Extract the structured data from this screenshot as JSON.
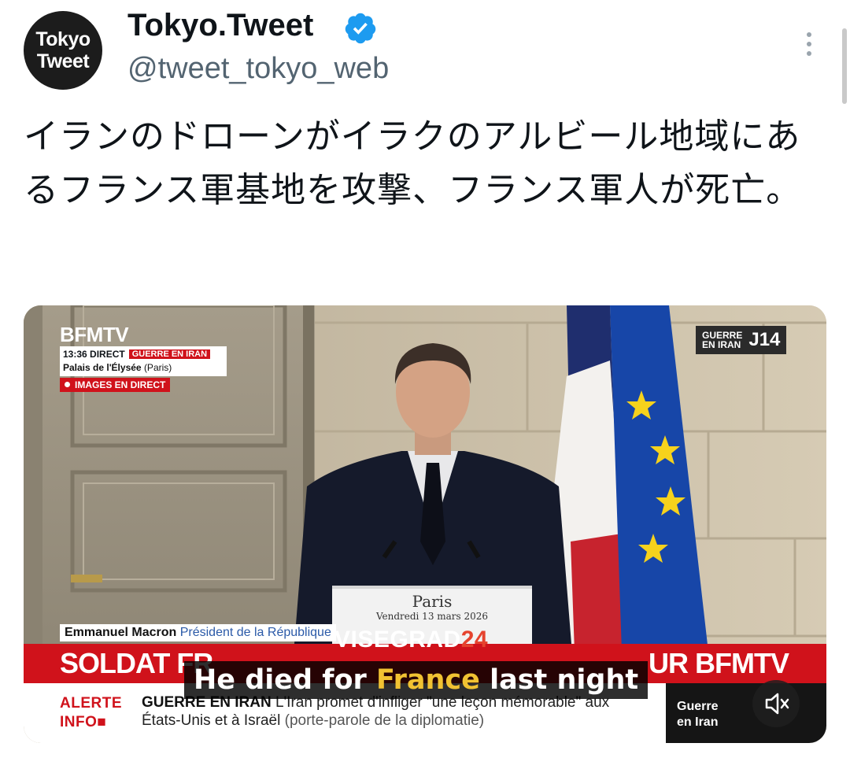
{
  "account": {
    "avatar_line1": "Tokyo",
    "avatar_line2": "Tweet",
    "display_name": "Tokyo.Tweet",
    "handle": "@tweet_tokyo_web"
  },
  "tweet": {
    "text": "イランのドローンがイラクのアルビール地域にあるフランス軍基地を攻撃、フランス軍人が死亡。"
  },
  "video": {
    "channel_logo": "BFMTV",
    "time": "13:36",
    "direct_label": "DIRECT",
    "segment_tag": "GUERRE EN IRAN",
    "location": "Palais de l'Élysée",
    "location_city": "(Paris)",
    "live_label": "IMAGES EN DIRECT",
    "corner_tag_small_1": "GUERRE",
    "corner_tag_small_2": "EN IRAN",
    "corner_tag_big": "J14",
    "lectern_city": "Paris",
    "lectern_date": "Vendredi 13 mars 2026",
    "speaker_name": "Emmanuel Macron",
    "speaker_role": "Président de la République",
    "watermark": "VISEGRAD",
    "watermark_num": "24",
    "headline_left": "SOLDAT FR",
    "headline_right": "UR BFMTV",
    "alert_label_1": "ALERTE",
    "alert_label_2": "INFO",
    "alert_title": "GUERRE EN IRAN",
    "alert_text": "L'Iran promet d'infliger \"une leçon mémorable\" aux",
    "alert_line2": "États-Unis et à Israël",
    "alert_line2_source": "(porte-parole de la diplomatie)",
    "side_label_1": "Guerre",
    "side_label_2": "en Iran",
    "caption_pre": "He died for ",
    "caption_highlight": "France",
    "caption_post": " last night"
  },
  "colors": {
    "verified": "#1d9bf0",
    "bfm_red": "#d0121b",
    "caption_highlight": "#f1c232",
    "handle_gray": "#536471"
  },
  "icons": [
    "verified-badge-icon",
    "more-options-icon",
    "mute-icon"
  ]
}
